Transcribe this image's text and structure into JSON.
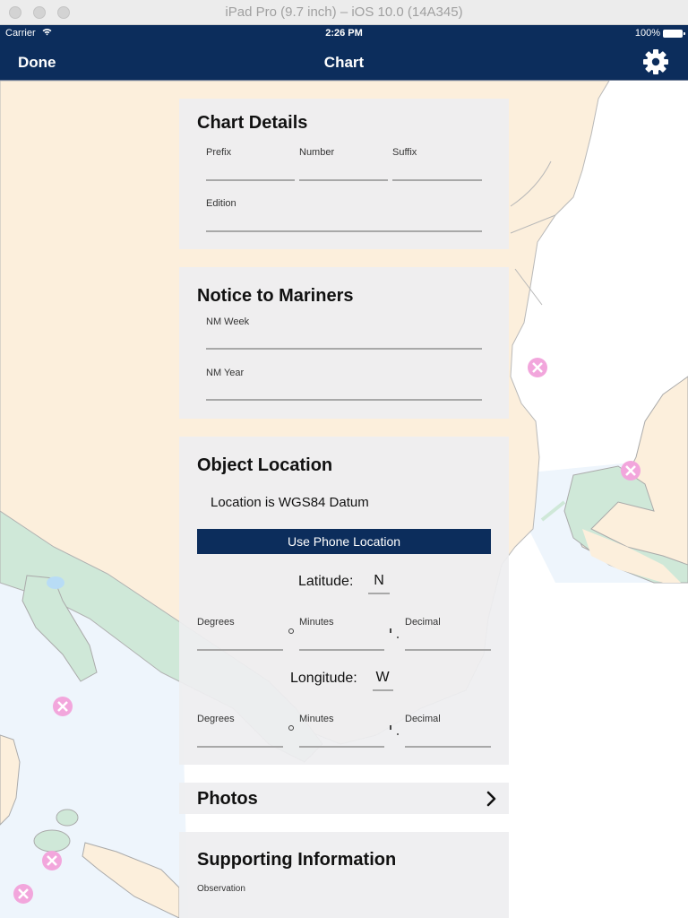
{
  "window": {
    "title": "iPad Pro (9.7 inch) – iOS 10.0 (14A345)"
  },
  "status_bar": {
    "carrier": "Carrier",
    "time": "2:26 PM",
    "battery": "100%",
    "battery_level_percent": 100
  },
  "nav": {
    "done_label": "Done",
    "title": "Chart",
    "settings_icon": "gear-icon"
  },
  "colors": {
    "nav_bg": "#0c2d5c",
    "land": "#fcefdc",
    "shallow": "#cfe8d8",
    "water_light": "#eef5fc",
    "marker": "#f2a6dc"
  },
  "chart_details": {
    "title": "Chart Details",
    "prefix_label": "Prefix",
    "prefix_value": "",
    "number_label": "Number",
    "number_value": "",
    "suffix_label": "Suffix",
    "suffix_value": "",
    "edition_label": "Edition",
    "edition_value": ""
  },
  "notice_to_mariners": {
    "title": "Notice to Mariners",
    "week_label": "NM Week",
    "week_value": "",
    "year_label": "NM Year",
    "year_value": ""
  },
  "object_location": {
    "title": "Object Location",
    "datum_text": "Location is WGS84 Datum",
    "use_phone_button": "Use Phone Location",
    "latitude": {
      "label": "Latitude:",
      "hemisphere": "N",
      "degrees_label": "Degrees",
      "degrees_value": "",
      "minutes_label": "Minutes",
      "minutes_value": "",
      "decimal_label": "Decimal",
      "decimal_value": ""
    },
    "longitude": {
      "label": "Longitude:",
      "hemisphere": "W",
      "degrees_label": "Degrees",
      "degrees_value": "",
      "minutes_label": "Minutes",
      "minutes_value": "",
      "decimal_label": "Decimal",
      "decimal_value": ""
    }
  },
  "photos": {
    "title": "Photos",
    "chevron_icon": "chevron-right-icon"
  },
  "supporting_information": {
    "title": "Supporting Information",
    "observation_label": "Observation",
    "observation_value": ""
  }
}
